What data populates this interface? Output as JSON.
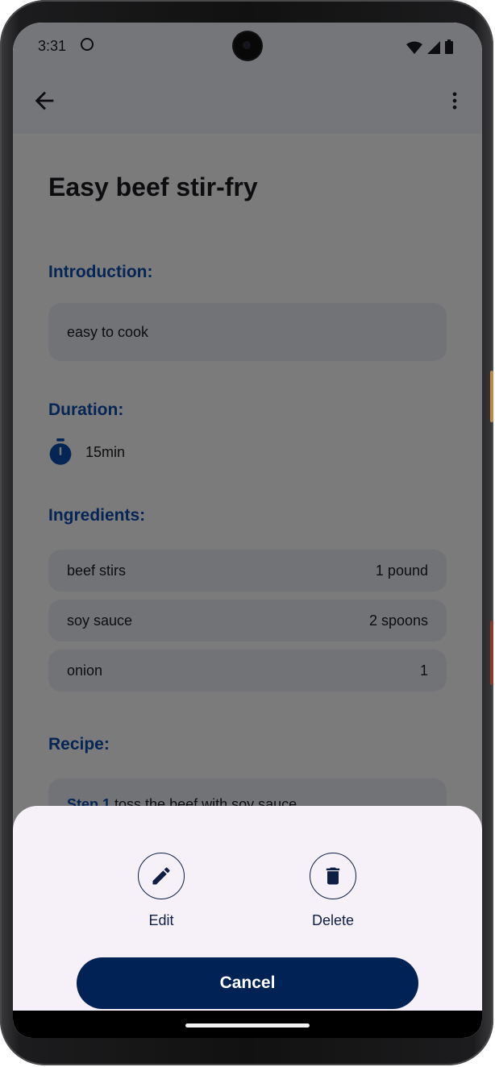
{
  "status_bar": {
    "time": "3:31"
  },
  "recipe": {
    "title": "Easy beef stir-fry",
    "introduction_label": "Introduction:",
    "introduction": "easy to cook",
    "duration_label": "Duration:",
    "duration": "15min",
    "ingredients_label": "Ingredients:",
    "ingredients": [
      {
        "name": "beef stirs",
        "amount": "1 pound"
      },
      {
        "name": "soy sauce",
        "amount": "2 spoons"
      },
      {
        "name": "onion",
        "amount": "1"
      }
    ],
    "recipe_label": "Recipe:",
    "first_step": {
      "label": "Step 1",
      "text": " toss the beef with soy sauce"
    }
  },
  "bottom_sheet": {
    "edit_label": "Edit",
    "delete_label": "Delete",
    "cancel_label": "Cancel"
  },
  "colors": {
    "accent": "#0a4aa8",
    "primary_button": "#002255",
    "sheet_background": "#f6f0f9"
  }
}
